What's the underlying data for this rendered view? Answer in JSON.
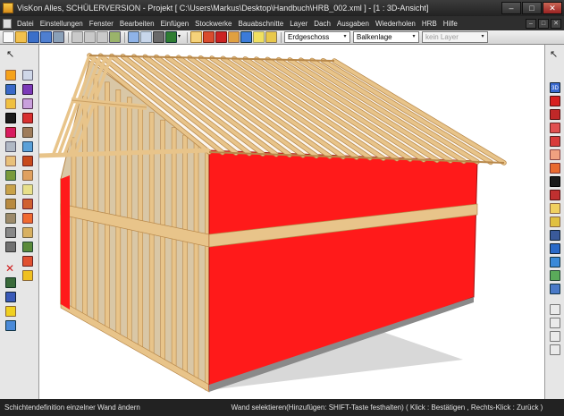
{
  "window": {
    "title": "VisKon Alles, SCHÜLERVERSION - Projekt [ C:\\Users\\Markus\\Desktop\\Handbuch\\HRB_002.xml ] - [1 : 3D-Ansicht]",
    "minimize": "–",
    "maximize": "□",
    "close": "✕"
  },
  "menu": {
    "items": [
      "Datei",
      "Einstellungen",
      "Fenster",
      "Bearbeiten",
      "Einfügen",
      "Stockwerke",
      "Bauabschnitte",
      "Layer",
      "Dach",
      "Ausgaben",
      "Wiederholen",
      "HRB",
      "Hilfe"
    ],
    "mdi": [
      "–",
      "□",
      "✕"
    ]
  },
  "toolbar": {
    "floor_select": "Erdgeschoss",
    "layer_select": "Balkenlage",
    "layer2_select": "kein Layer",
    "arrow": "▾"
  },
  "statusbar": {
    "left": "Schichtendefinition einzelner Wand ändern",
    "right": "Wand selektieren(Hinzufügen: SHIFT-Taste festhalten) ( Klick : Bestätigen , Rechts-Klick : Zurück )"
  },
  "colors": {
    "wall_red": "#ff1a1a",
    "timber": "#e8c48a",
    "timber_dark": "#b8884a",
    "background": "#ffffff"
  },
  "icons": {
    "right_3d_label": "3D"
  }
}
